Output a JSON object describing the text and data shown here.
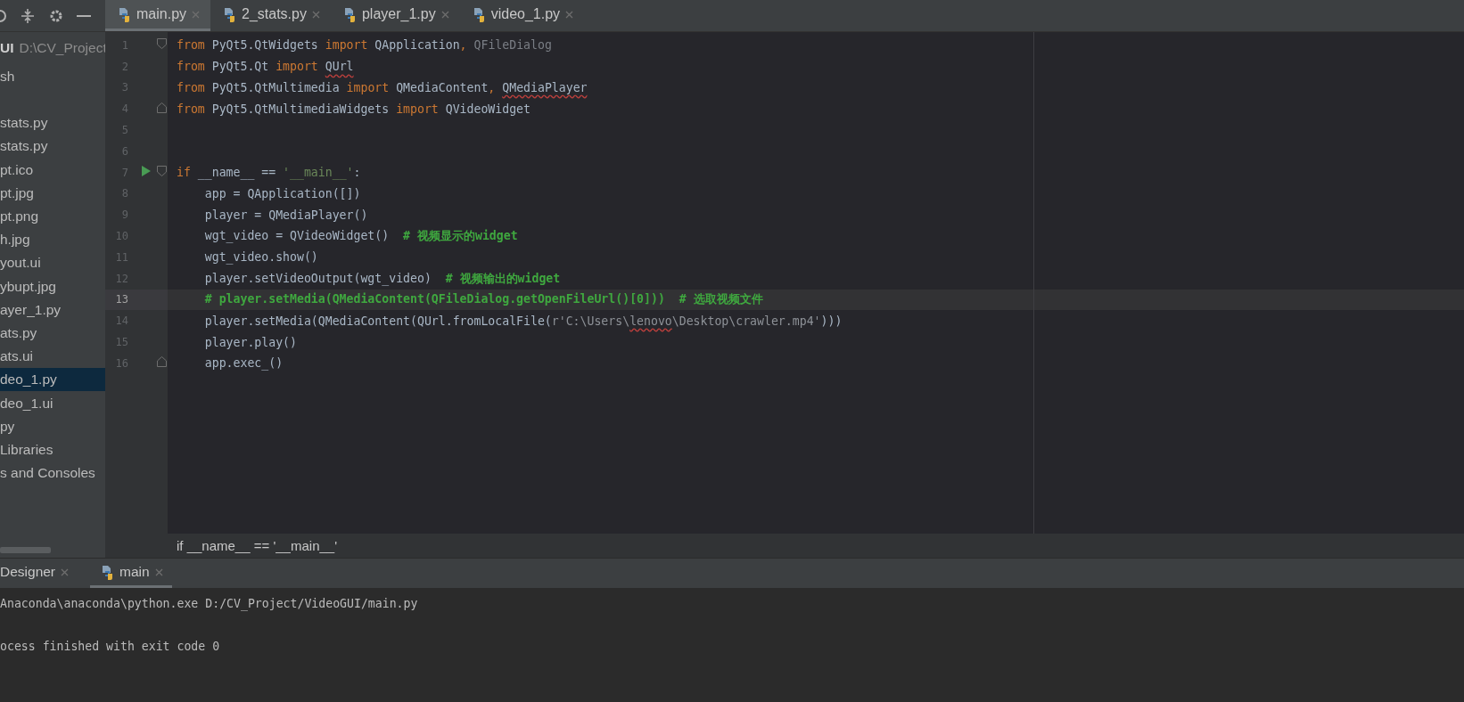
{
  "editor_tabs": [
    {
      "label": "main.py",
      "selected": true
    },
    {
      "label": "2_stats.py",
      "selected": false
    },
    {
      "label": "player_1.py",
      "selected": false
    },
    {
      "label": "video_1.py",
      "selected": false
    }
  ],
  "project": {
    "root_name": "UI",
    "root_path": "D:\\CV_Project",
    "items": [
      {
        "label": "sh",
        "selected": false
      },
      {
        "label": "stats.py",
        "selected": false,
        "gap_before": true
      },
      {
        "label": "stats.py",
        "selected": false
      },
      {
        "label": "pt.ico",
        "selected": false
      },
      {
        "label": "pt.jpg",
        "selected": false
      },
      {
        "label": "pt.png",
        "selected": false
      },
      {
        "label": "h.jpg",
        "selected": false
      },
      {
        "label": "yout.ui",
        "selected": false
      },
      {
        "label": "ybupt.jpg",
        "selected": false
      },
      {
        "label": "ayer_1.py",
        "selected": false
      },
      {
        "label": "ats.py",
        "selected": false
      },
      {
        "label": "ats.ui",
        "selected": false
      },
      {
        "label": "deo_1.py",
        "selected": true
      },
      {
        "label": "deo_1.ui",
        "selected": false
      },
      {
        "label": "py",
        "selected": false
      },
      {
        "label": "Libraries",
        "selected": false
      },
      {
        "label": "s and Consoles",
        "selected": false
      }
    ]
  },
  "code": {
    "lines": [
      {
        "number": "1",
        "current": false,
        "fold_start": true,
        "tokens": [
          {
            "t": "from ",
            "kind": "kw"
          },
          {
            "t": "PyQt5.QtWidgets ",
            "kind": "text"
          },
          {
            "t": "import ",
            "kind": "kw"
          },
          {
            "t": "QApplication",
            "kind": "text"
          },
          {
            "t": ", ",
            "kind": "kw"
          },
          {
            "t": "QFileDialog",
            "kind": "dim"
          }
        ]
      },
      {
        "number": "2",
        "current": false,
        "tokens": [
          {
            "t": "from ",
            "kind": "kw"
          },
          {
            "t": "PyQt5.Qt ",
            "kind": "text"
          },
          {
            "t": "import ",
            "kind": "kw"
          },
          {
            "t": "QUrl",
            "kind": "text",
            "squiggle": true
          }
        ]
      },
      {
        "number": "3",
        "current": false,
        "tokens": [
          {
            "t": "from ",
            "kind": "kw"
          },
          {
            "t": "PyQt5.QtMultimedia ",
            "kind": "text"
          },
          {
            "t": "import ",
            "kind": "kw"
          },
          {
            "t": "QMediaContent",
            "kind": "text"
          },
          {
            "t": ", ",
            "kind": "kw"
          },
          {
            "t": "QMediaPlayer",
            "kind": "text",
            "squiggle": true
          }
        ]
      },
      {
        "number": "4",
        "current": false,
        "fold_end": true,
        "tokens": [
          {
            "t": "from ",
            "kind": "kw"
          },
          {
            "t": "PyQt5.QtMultimediaWidgets ",
            "kind": "text"
          },
          {
            "t": "import ",
            "kind": "kw"
          },
          {
            "t": "QVideoWidget",
            "kind": "text"
          }
        ]
      },
      {
        "number": "5",
        "current": false
      },
      {
        "number": "6",
        "current": false
      },
      {
        "number": "7",
        "current": false,
        "fold_start": true,
        "run": true,
        "tokens": [
          {
            "t": "if ",
            "kind": "kw"
          },
          {
            "t": "__name__ == ",
            "kind": "text"
          },
          {
            "t": "'__main__'",
            "kind": "str"
          },
          {
            "t": ":",
            "kind": "text"
          }
        ]
      },
      {
        "number": "8",
        "current": false,
        "tokens": [
          {
            "t": "    app = QApplication([])",
            "kind": "text"
          }
        ]
      },
      {
        "number": "9",
        "current": false,
        "tokens": [
          {
            "t": "    player = QMediaPlayer()",
            "kind": "text"
          }
        ]
      },
      {
        "number": "10",
        "current": false,
        "tokens": [
          {
            "t": "    wgt_video = QVideoWidget()  ",
            "kind": "text"
          },
          {
            "t": "# 视频显示的widget",
            "kind": "comment"
          }
        ]
      },
      {
        "number": "11",
        "current": false,
        "tokens": [
          {
            "t": "    wgt_video.show()",
            "kind": "text"
          }
        ]
      },
      {
        "number": "12",
        "current": false,
        "tokens": [
          {
            "t": "    player.setVideoOutput(wgt_video)  ",
            "kind": "text"
          },
          {
            "t": "# 视频输出的widget",
            "kind": "comment"
          }
        ]
      },
      {
        "number": "13",
        "current": true,
        "tokens": [
          {
            "t": "    # player.setMedia(QMediaContent(QFileDialog.getOpenFileUrl()[0]))  # 选取视频文件",
            "kind": "comment"
          }
        ]
      },
      {
        "number": "14",
        "current": false,
        "tokens": [
          {
            "t": "    player.setMedia(QMediaContent(QUrl.fromLocalFile(",
            "kind": "text"
          },
          {
            "t": "r'C:\\Users\\",
            "kind": "path"
          },
          {
            "t": "lenovo",
            "kind": "path",
            "squiggle": true
          },
          {
            "t": "\\Desktop\\crawler.mp4'",
            "kind": "path"
          },
          {
            "t": ")))",
            "kind": "text"
          }
        ]
      },
      {
        "number": "15",
        "current": false,
        "tokens": [
          {
            "t": "    player.play()",
            "kind": "text"
          }
        ]
      },
      {
        "number": "16",
        "current": false,
        "fold_end": true,
        "tokens": [
          {
            "t": "    app.exec_()",
            "kind": "text"
          }
        ]
      }
    ]
  },
  "breadcrumb": "if __name__ == '__main__'",
  "run_tabs": [
    {
      "label": "Designer",
      "selected": false,
      "kind": "plain"
    },
    {
      "label": "main",
      "selected": true,
      "kind": "python"
    }
  ],
  "console": [
    {
      "text": "Anaconda\\anaconda\\python.exe D:/CV_Project/VideoGUI/main.py"
    },
    {
      "text": "ocess finished with exit code 0",
      "gap_before": true
    }
  ]
}
